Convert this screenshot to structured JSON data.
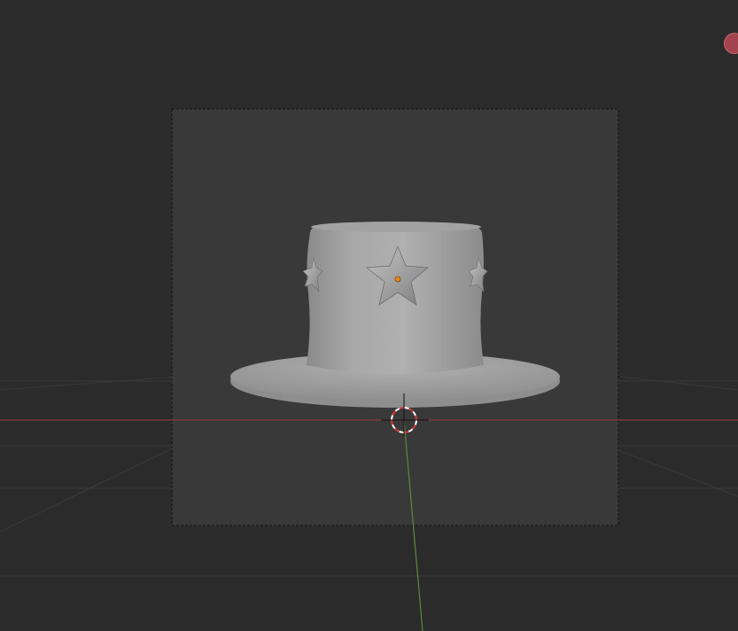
{
  "app": {
    "view": "3D Viewport",
    "object": "top-hat"
  },
  "colors": {
    "background": "#2b2b2b",
    "camera_frame": "#393939",
    "grid_line": "#363636",
    "x_axis": "#8a3a40",
    "y_axis": "#5d8a3a",
    "mesh": "#9a9a9a",
    "origin_dot": "#f08a1a",
    "gizmo_x": "#b04652"
  },
  "icons": {
    "cursor": "3d-cursor-icon",
    "gizmo_x": "navigation-gizmo-x-ball"
  }
}
